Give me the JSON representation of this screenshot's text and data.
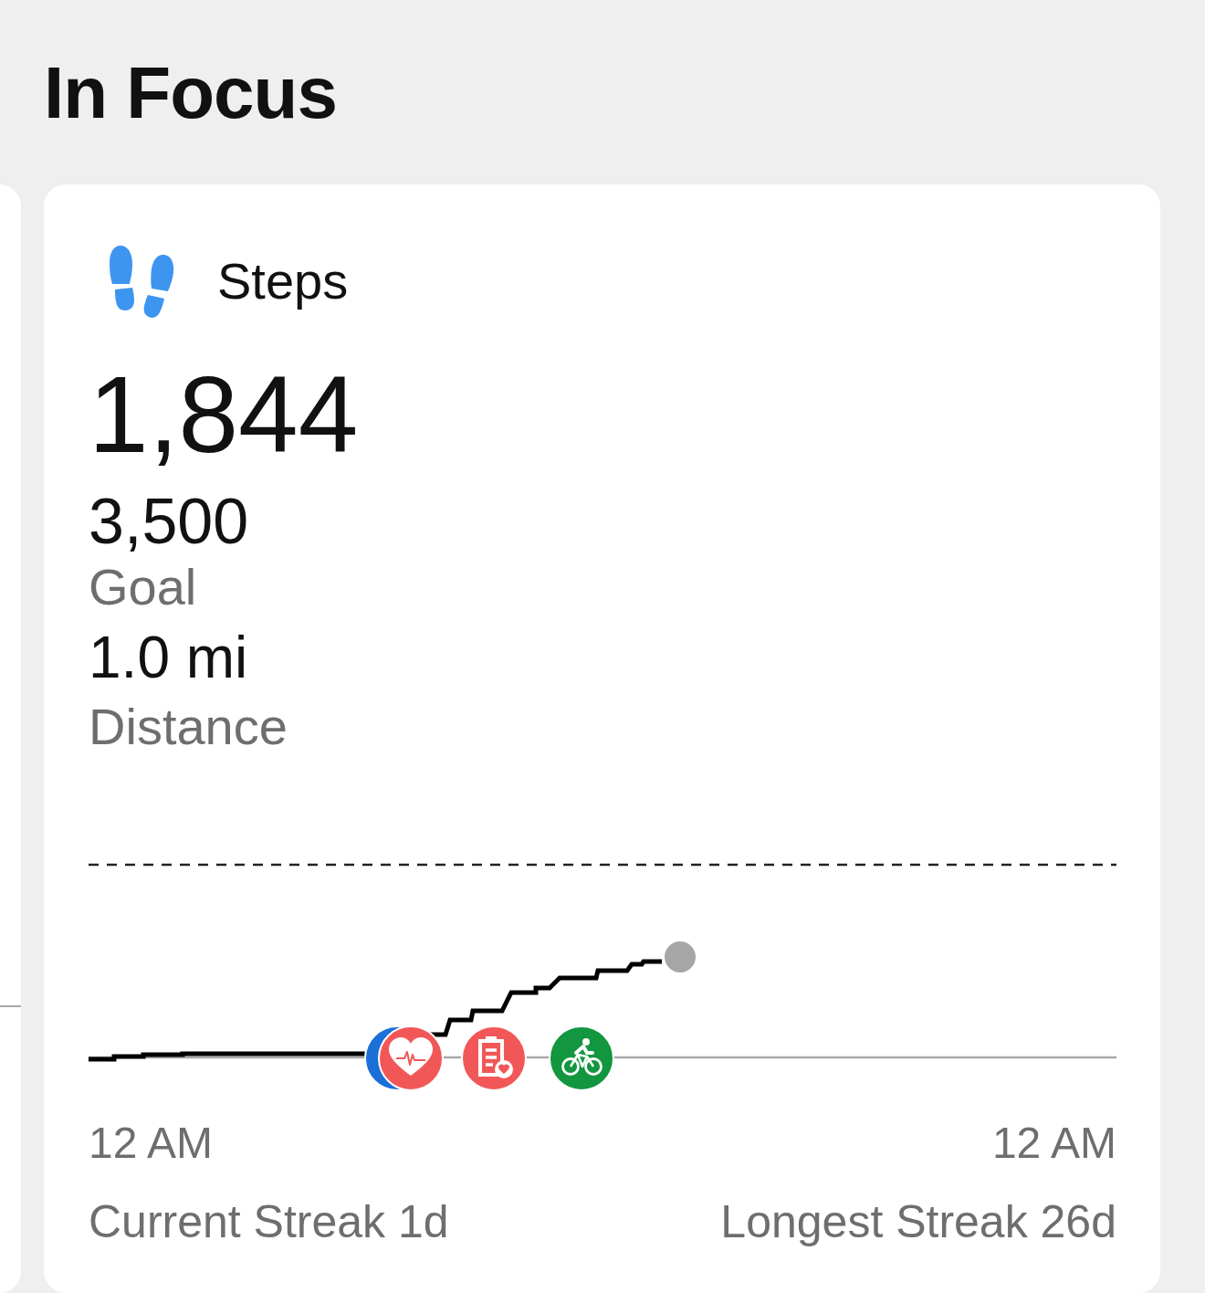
{
  "header": {
    "title": "In Focus"
  },
  "card": {
    "title": "Steps",
    "value": "1,844",
    "stats": [
      {
        "value": "3,500",
        "label": "Goal"
      },
      {
        "value": "1.0 mi",
        "label": "Distance"
      }
    ],
    "chart": {
      "activities": [
        {
          "kind": "plain",
          "color": "#1b6fd6"
        },
        {
          "kind": "heart",
          "color": "#f25757"
        },
        {
          "kind": "clipboard",
          "color": "#f25757"
        },
        {
          "kind": "cycling",
          "color": "#12963f"
        }
      ],
      "x_labels": [
        "12 AM",
        "12 AM"
      ]
    },
    "streaks": [
      "Current Streak 1d",
      "Longest Streak 26d"
    ]
  }
}
